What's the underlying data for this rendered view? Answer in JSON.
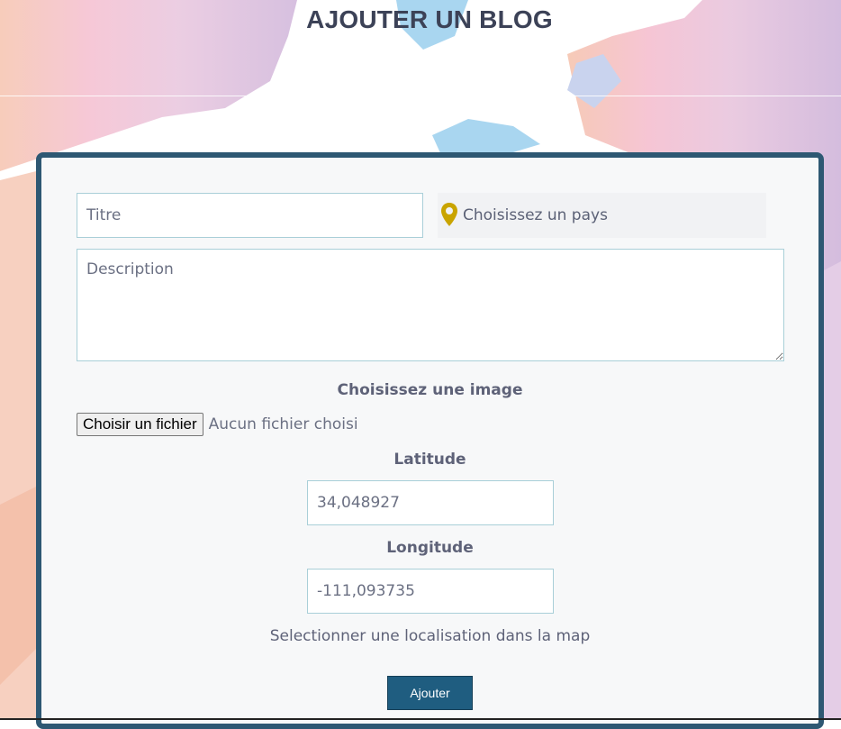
{
  "header": {
    "title": "AJOUTER UN BLOG"
  },
  "form": {
    "title_placeholder": "Titre",
    "country": {
      "icon": "map-pin-icon",
      "icon_color": "#c9a400",
      "label": "Choisissez un pays"
    },
    "description_placeholder": "Description",
    "image_label": "Choisissez une image",
    "file_button_label": "Choisir un fichier",
    "file_status": "Aucun fichier choisi",
    "latitude_label": "Latitude",
    "latitude_value": "34,048927",
    "longitude_label": "Longitude",
    "longitude_value": "-111,093735",
    "map_hint": "Selectionner une localisation dans la map",
    "submit_label": "Ajouter"
  },
  "colors": {
    "card_border": "#2e5873",
    "submit_bg": "#1f5d80",
    "title_text": "#3c4257"
  }
}
